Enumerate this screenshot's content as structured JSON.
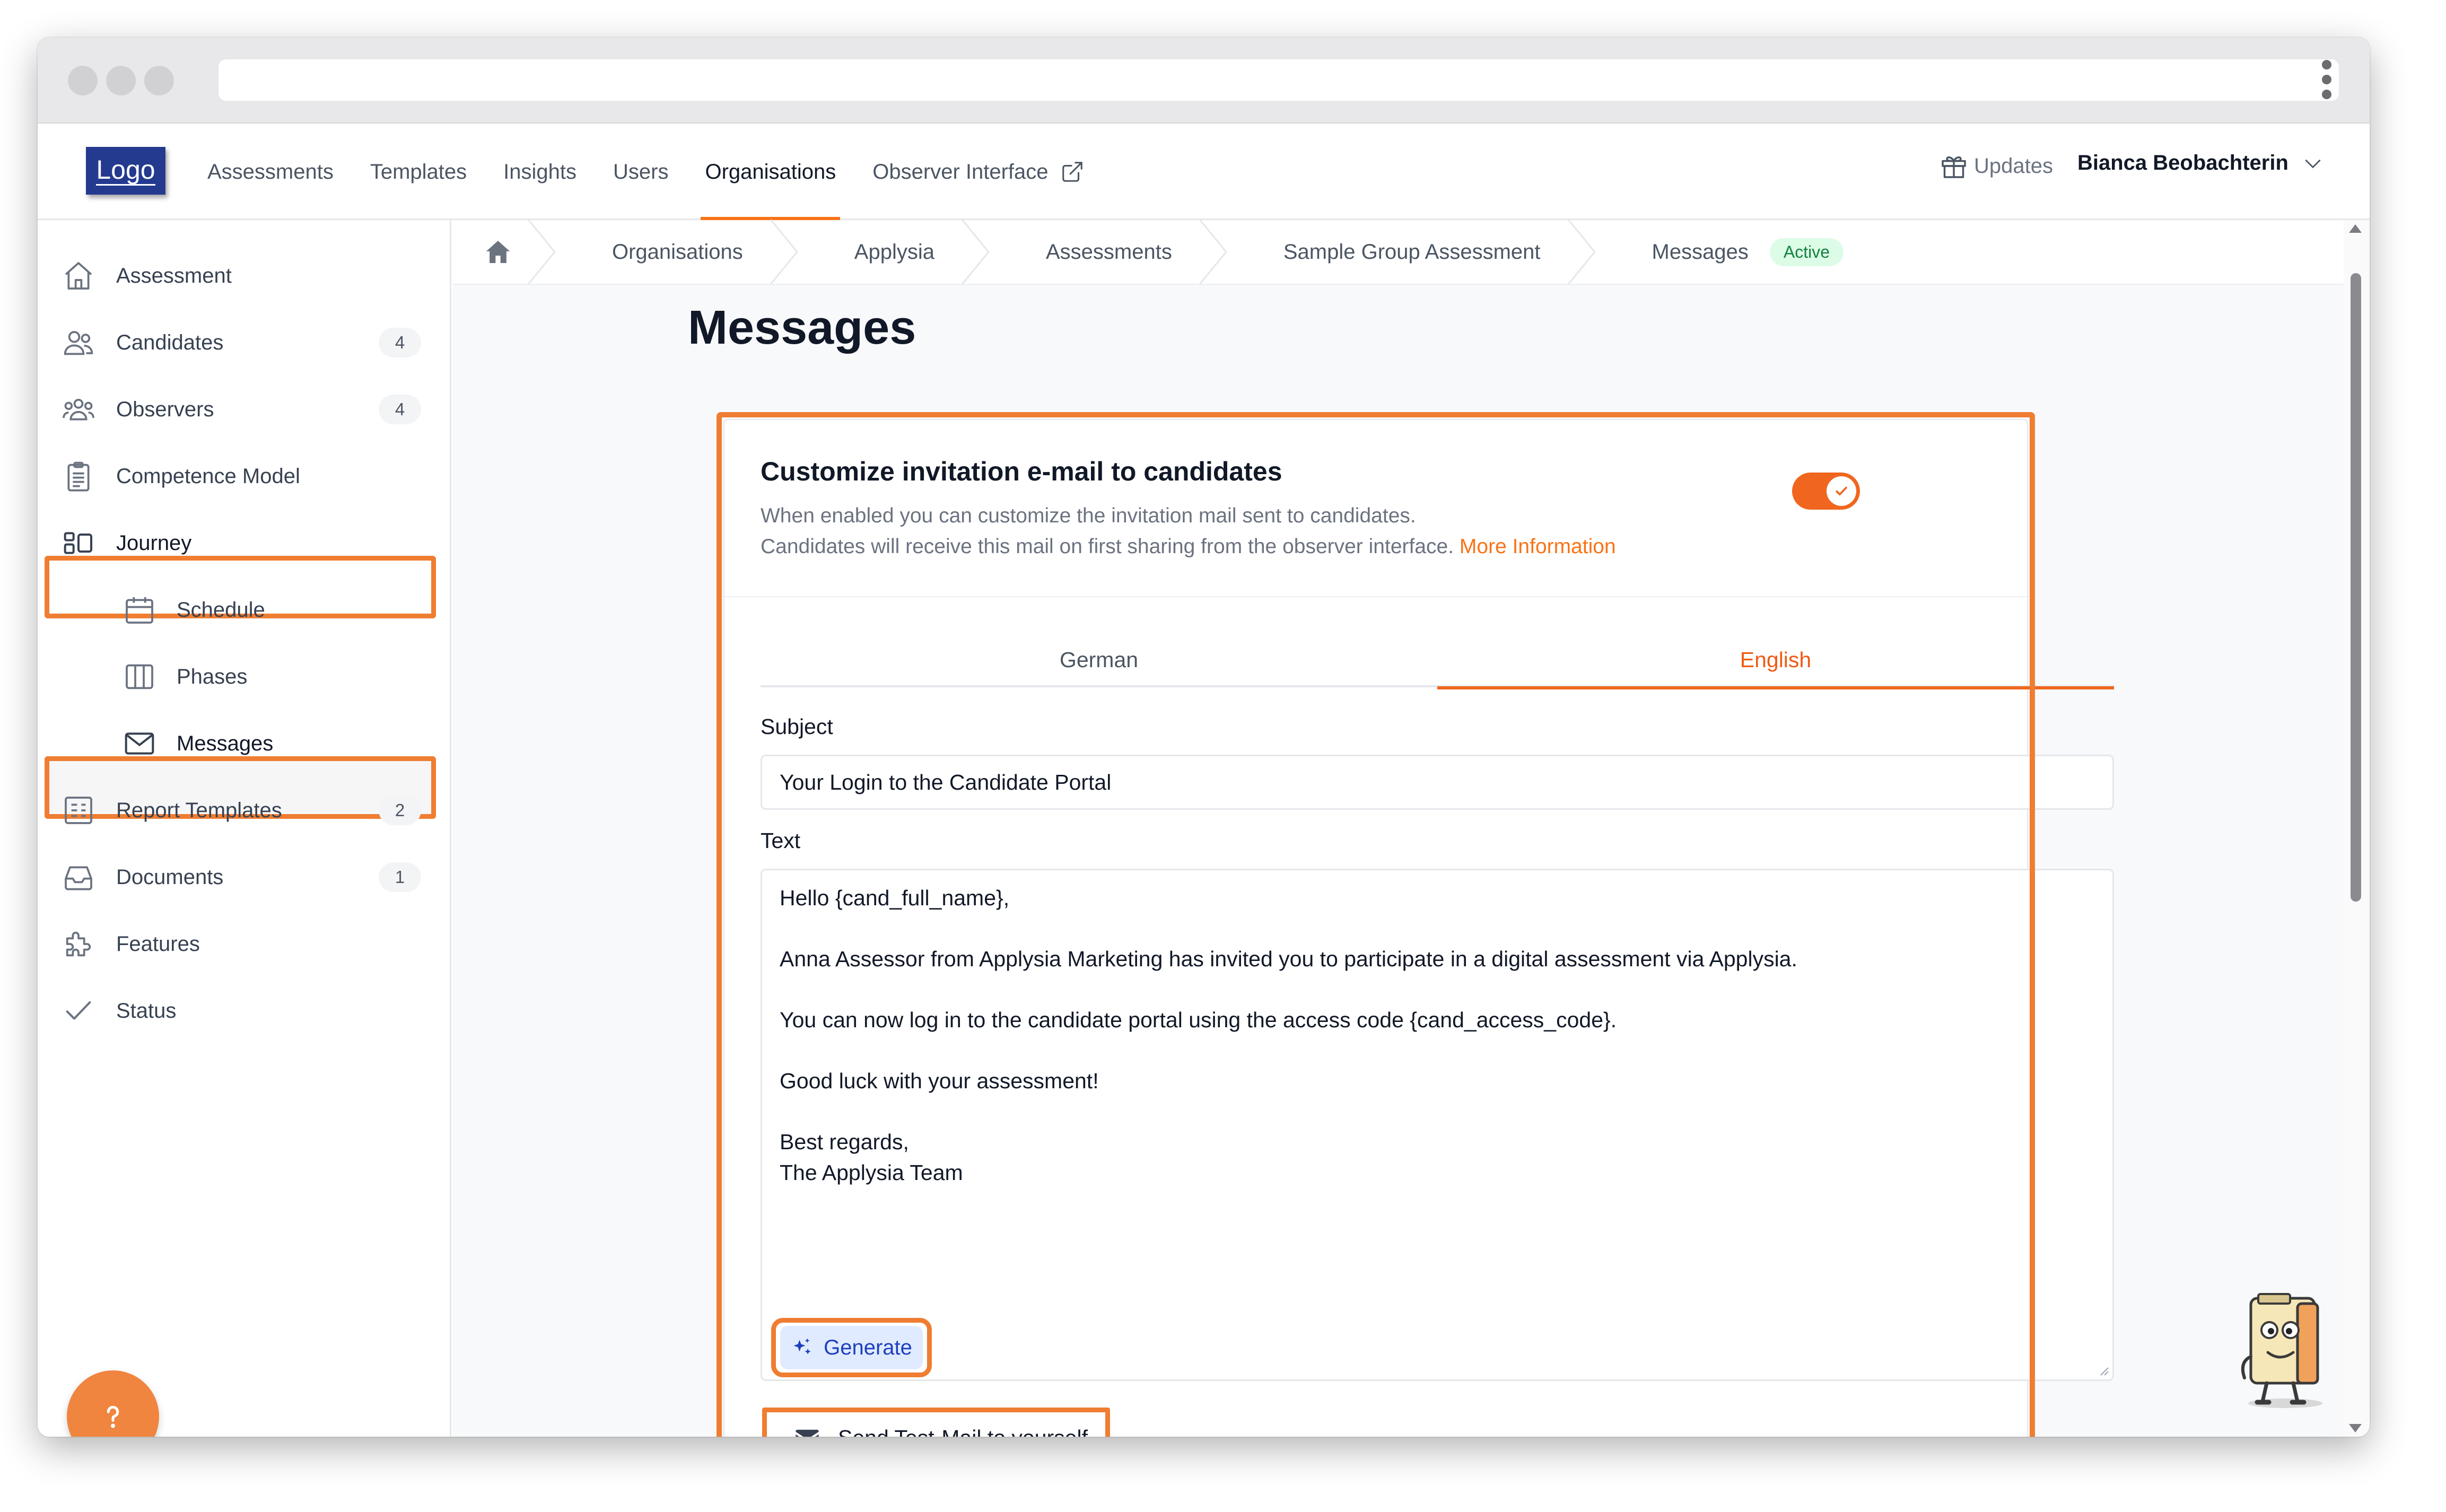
{
  "topnav": {
    "logo": "Logo",
    "links": [
      {
        "label": "Assessments"
      },
      {
        "label": "Templates"
      },
      {
        "label": "Insights"
      },
      {
        "label": "Users"
      },
      {
        "label": "Organisations",
        "active": true
      },
      {
        "label": "Observer Interface"
      }
    ],
    "updates_label": "Updates",
    "user_name": "Bianca Beobachterin"
  },
  "sidebar": {
    "items": [
      {
        "label": "Assessment",
        "icon": "home-icon"
      },
      {
        "label": "Candidates",
        "icon": "users-icon",
        "badge": "4"
      },
      {
        "label": "Observers",
        "icon": "user-group-icon",
        "badge": "4"
      },
      {
        "label": "Competence Model",
        "icon": "clipboard-icon"
      },
      {
        "label": "Journey",
        "icon": "journey-icon",
        "highlighted": true
      },
      {
        "label": "Schedule",
        "icon": "calendar-icon",
        "sub": true
      },
      {
        "label": "Phases",
        "icon": "columns-icon",
        "sub": true
      },
      {
        "label": "Messages",
        "icon": "envelope-icon",
        "sub": true,
        "active": true,
        "highlighted": true
      },
      {
        "label": "Report Templates",
        "icon": "report-icon",
        "badge": "2"
      },
      {
        "label": "Documents",
        "icon": "inbox-icon",
        "badge": "1"
      },
      {
        "label": "Features",
        "icon": "puzzle-icon"
      },
      {
        "label": "Status",
        "icon": "check-icon"
      }
    ]
  },
  "breadcrumbs": [
    {
      "label": "Organisations"
    },
    {
      "label": "Applysia"
    },
    {
      "label": "Assessments"
    },
    {
      "label": "Sample Group Assessment"
    },
    {
      "label": "Messages"
    }
  ],
  "status_badge": "Active",
  "page_title": "Messages",
  "card": {
    "title": "Customize invitation e-mail to candidates",
    "desc_line1": "When enabled you can customize the invitation mail sent to candidates.",
    "desc_line2": "Candidates will receive this mail on first sharing from the observer interface.",
    "more_info": "More Information",
    "toggle_enabled": true,
    "tabs": [
      {
        "label": "German"
      },
      {
        "label": "English",
        "active": true
      }
    ],
    "subject_label": "Subject",
    "subject_value": "Your Login to the Candidate Portal",
    "text_label": "Text",
    "text_lines": [
      "Hello {cand_full_name},",
      "",
      "Anna Assessor from Applysia Marketing has invited you to participate in a digital assessment via Applysia.",
      "",
      "You can now log in to the candidate portal using the access code {cand_access_code}.",
      "",
      "Good luck with your assessment!",
      "",
      "Best regards,",
      "The Applysia Team"
    ],
    "generate_label": "Generate",
    "test_mail_label": "Send Test-Mail to yourself"
  },
  "colors": {
    "accent": "#f97316",
    "highlight": "#ef7d32",
    "logo_bg": "#243a8f",
    "badge_green_bg": "#dcfce7",
    "badge_green_text": "#15803d"
  }
}
